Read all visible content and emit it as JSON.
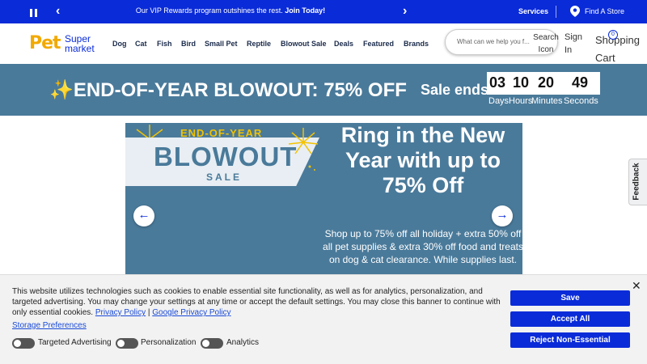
{
  "topbar": {
    "promo_text": "Our VIP Rewards program outshines the rest.",
    "promo_link": "Join Today!",
    "services": "Services",
    "find_store": "Find A Store"
  },
  "header": {
    "logo_pet": "Pet",
    "logo_supermarket": "Super market",
    "nav": [
      "Dog",
      "Cat",
      "Fish",
      "Bird",
      "Small Pet",
      "Reptile",
      "Blowout Sale",
      "Deals",
      "Featured",
      "Brands"
    ],
    "search_placeholder": "What can we help you f...",
    "search_icon_label": "Search Icon",
    "signin": "Sign In",
    "cart_label": "Shopping Cart",
    "cart_count": "0"
  },
  "strip": {
    "headline_icon": "✨",
    "headline": "END-OF-YEAR BLOWOUT: 75% OFF",
    "sale_ends": "Sale ends:",
    "countdown": {
      "days": "03",
      "hours": "10",
      "minutes": "20",
      "seconds": "49"
    },
    "labels": {
      "days": "Days",
      "hours": "Hours",
      "minutes": "Minutes",
      "seconds": "Seconds"
    }
  },
  "hero": {
    "eyebrow": "END-OF-YEAR",
    "blowout": "BLOWOUT",
    "sale": "SALE",
    "big_copy": "Ring in the New Year with up to 75% Off",
    "small_copy": "Shop up to 75% off all holiday + extra 50% off all pet supplies & extra 30% off food and treats on dog & cat clearance. While supplies last."
  },
  "feedback": "Feedback",
  "cookie": {
    "message": "This website utilizes technologies such as cookies to enable essential site functionality, as well as for analytics, personalization, and targeted advertising. You may change your settings at any time or accept the default settings. You may close this banner to continue with only essential cookies.",
    "privacy_policy": "Privacy Policy",
    "separator": "|",
    "google_privacy_policy": "Google Privacy Policy",
    "storage_preferences": "Storage Preferences",
    "toggles": [
      "Targeted Advertising",
      "Personalization",
      "Analytics"
    ],
    "save": "Save",
    "accept_all": "Accept All",
    "reject": "Reject Non-Essential",
    "close": "✕"
  },
  "colors": {
    "brand_blue": "#0a2bd8",
    "brand_yellow": "#f2a900",
    "banner_teal": "#4a7a9a"
  }
}
